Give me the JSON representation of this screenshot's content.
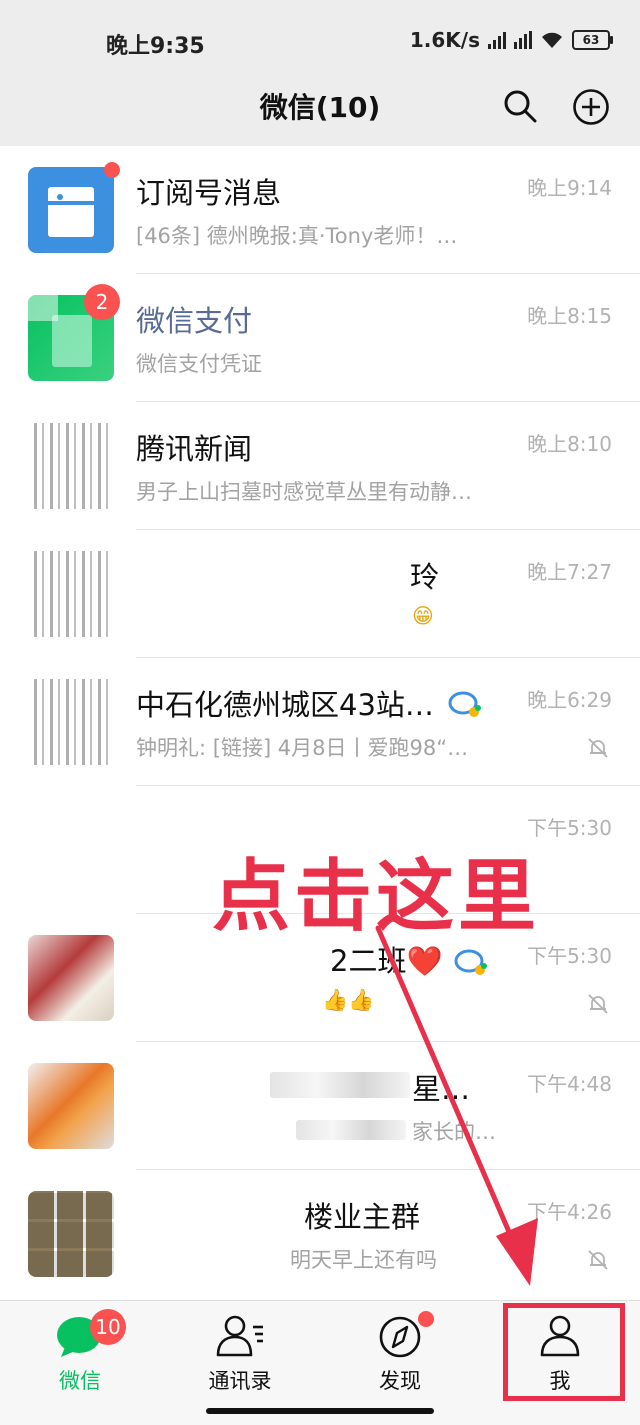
{
  "status_bar": {
    "time": "晚上9:35",
    "network_speed": "1.6K/s",
    "battery": "63"
  },
  "nav": {
    "title": "微信(10)"
  },
  "chats": [
    {
      "name": "订阅号消息",
      "message": "[46条] 德州晚报:真·Tony老师！…",
      "time": "晚上9:14",
      "name_style": "normal",
      "unread": "dot"
    },
    {
      "name": "微信支付",
      "message": "微信支付凭证",
      "time": "晚上8:15",
      "name_style": "blue",
      "badge": "2"
    },
    {
      "name": "腾讯新闻",
      "message": "男子上山扫墓时感觉草丛里有动静…",
      "time": "晚上8:10"
    },
    {
      "name": "玲",
      "message": "😁",
      "time": "晚上7:27"
    },
    {
      "name": "中石化德州城区43站…",
      "message": "钟明礼: [链接] 4月8日丨爱跑98“…",
      "time": "晚上6:29",
      "muted": true
    },
    {
      "name": "",
      "message": "",
      "time": "下午5:30"
    },
    {
      "name": "2二班❤️",
      "message": "👍👍",
      "time": "下午5:30",
      "muted": true
    },
    {
      "name": "星…",
      "message": "家长的…",
      "time": "下午4:48"
    },
    {
      "name": "楼业主群",
      "message": "明天早上还有吗",
      "time": "下午4:26",
      "muted": true
    }
  ],
  "annotation": {
    "text": "点击这里",
    "color": "#e8304a"
  },
  "tabs": [
    {
      "label": "微信",
      "badge": "10",
      "active": true
    },
    {
      "label": "通讯录"
    },
    {
      "label": "发现",
      "dot": true
    },
    {
      "label": "我",
      "highlighted": true
    }
  ],
  "colors": {
    "accent_green": "#07c160",
    "badge_red": "#fa5151",
    "link_blue": "#576b95",
    "bar_bg": "#ededed"
  }
}
